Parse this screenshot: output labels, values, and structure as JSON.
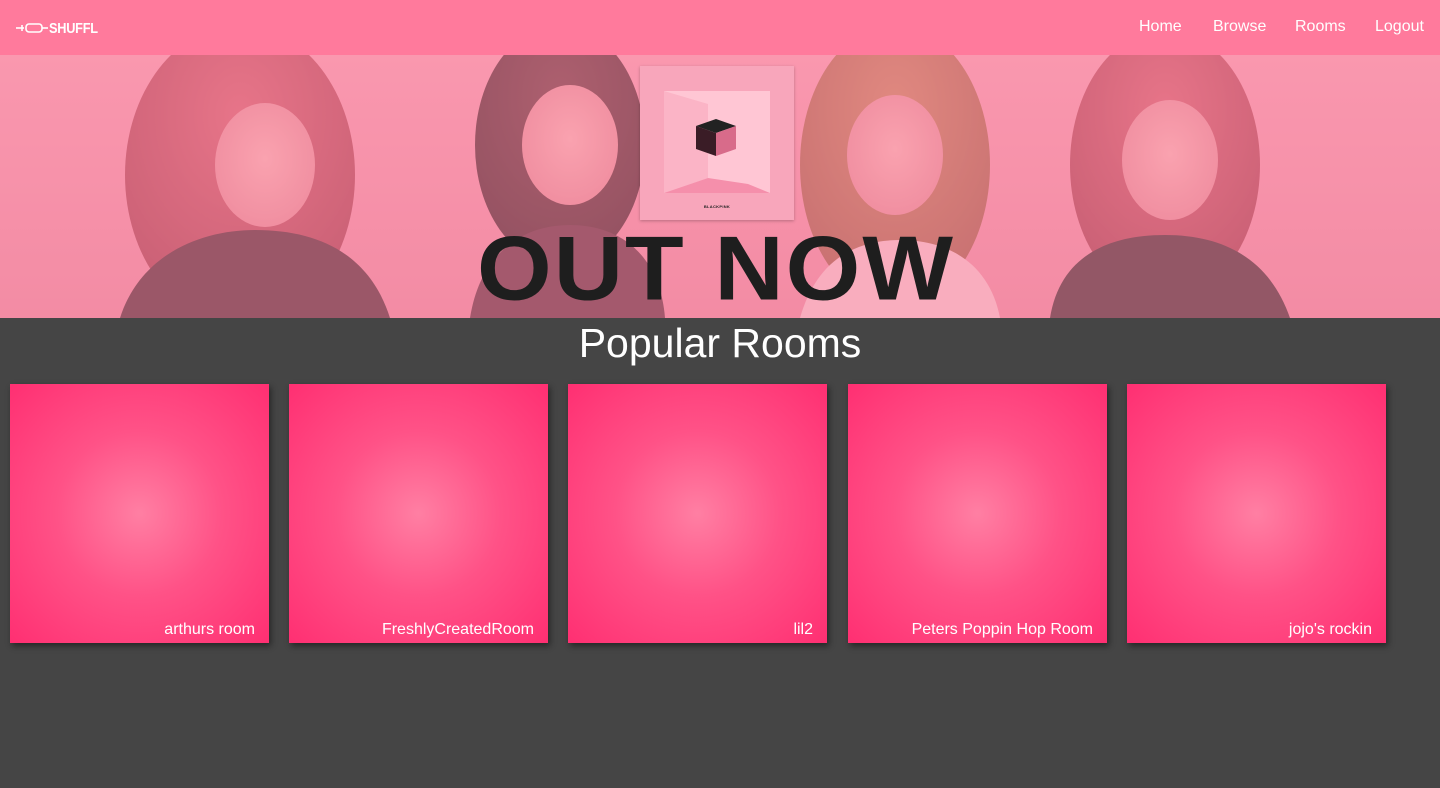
{
  "app": {
    "logo_text": "SHUFFL"
  },
  "nav": {
    "home": "Home",
    "browse": "Browse",
    "rooms": "Rooms",
    "logout": "Logout"
  },
  "banner": {
    "title": "OUT NOW",
    "album_label": "BLACKPINK"
  },
  "popular": {
    "title": "Popular Rooms",
    "rooms": [
      {
        "name": "arthurs room"
      },
      {
        "name": "FreshlyCreatedRoom"
      },
      {
        "name": "lil2"
      },
      {
        "name": "Peters Poppin Hop Room"
      },
      {
        "name": "jojo's rockin"
      }
    ]
  },
  "colors": {
    "navbar": "#ff7a9c",
    "background": "#454545",
    "card_edge": "#ff2f72",
    "card_center": "#ff7fa3"
  }
}
